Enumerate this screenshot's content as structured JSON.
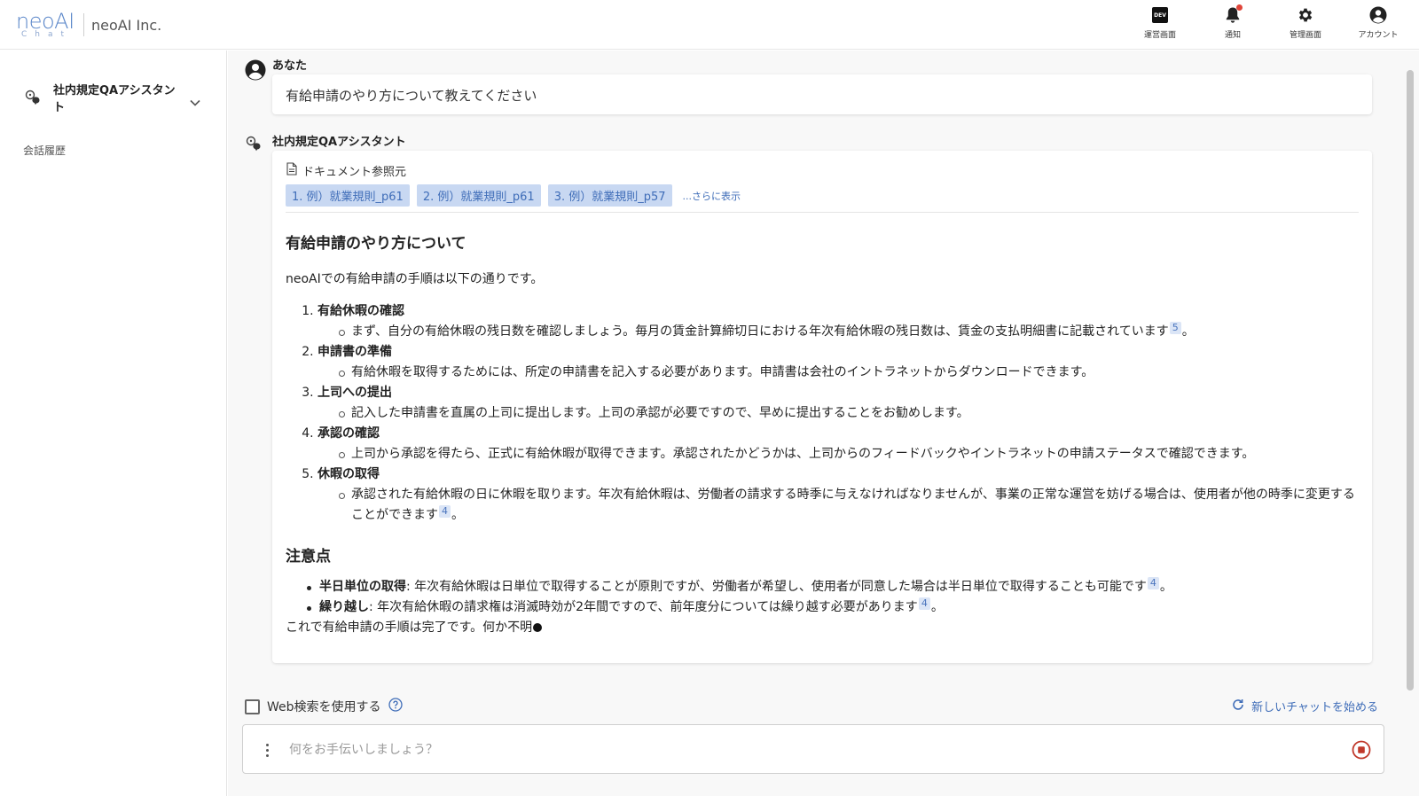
{
  "header": {
    "logo_text": "neoAI",
    "logo_sub": "Chat",
    "company": "neoAI Inc.",
    "actions": [
      {
        "label": "運営画面",
        "icon": "dev-icon",
        "badge": "DEV"
      },
      {
        "label": "通知",
        "icon": "bell-icon"
      },
      {
        "label": "管理画面",
        "icon": "gear-icon"
      },
      {
        "label": "アカウント",
        "icon": "account-icon"
      }
    ]
  },
  "sidebar": {
    "assistant_name": "社内規定QAアシスタント",
    "history_label": "会話履歴"
  },
  "chat": {
    "user": {
      "name": "あなた",
      "message": "有給申請のやり方について教えてください"
    },
    "bot": {
      "name": "社内規定QAアシスタント",
      "refs_label": "ドキュメント参照元",
      "refs": [
        "1. 例）就業規則_p61",
        "2. 例）就業規則_p61",
        "3. 例）就業規則_p57"
      ],
      "refs_more": "...さらに表示",
      "title": "有給申請のやり方について",
      "intro": "neoAIでの有給申請の手順は以下の通りです。",
      "steps": [
        {
          "title": "有給休暇の確認",
          "detail": "まず、自分の有給休暇の残日数を確認しましょう。毎月の賃金計算締切日における年次有給休暇の残日数は、賃金の支払明細書に記載されています",
          "cite": "5",
          "tail": "。"
        },
        {
          "title": "申請書の準備",
          "detail": "有給休暇を取得するためには、所定の申請書を記入する必要があります。申請書は会社のイントラネットからダウンロードできます。",
          "cite": "",
          "tail": ""
        },
        {
          "title": "上司への提出",
          "detail": "記入した申請書を直属の上司に提出します。上司の承認が必要ですので、早めに提出することをお勧めします。",
          "cite": "",
          "tail": ""
        },
        {
          "title": "承認の確認",
          "detail": "上司から承認を得たら、正式に有給休暇が取得できます。承認されたかどうかは、上司からのフィードバックやイントラネットの申請ステータスで確認できます。",
          "cite": "",
          "tail": ""
        },
        {
          "title": "休暇の取得",
          "detail": "承認された有給休暇の日に休暇を取ります。年次有給休暇は、労働者の請求する時季に与えなければなりませんが、事業の正常な運営を妨げる場合は、使用者が他の時季に変更することができます",
          "cite": "4",
          "tail": "。"
        }
      ],
      "notes_title": "注意点",
      "notes": [
        {
          "term": "半日単位の取得",
          "text": ": 年次有給休暇は日単位で取得することが原則ですが、労働者が希望し、使用者が同意した場合は半日単位で取得することも可能です",
          "cite": "4",
          "tail": "。"
        },
        {
          "term": "繰り越し",
          "text": ": 年次有給休暇の請求権は消滅時効が2年間ですので、前年度分については繰り越す必要があります",
          "cite": "4",
          "tail": "。"
        }
      ],
      "closing": "これで有給申請の手順は完了です。何か不明"
    }
  },
  "footer": {
    "web_search_label": "Web検索を使用する",
    "new_chat_label": "新しいチャットを始める",
    "input_placeholder": "何をお手伝いしましょう？"
  },
  "colors": {
    "accent": "#3f6db8",
    "chip_bg": "#c8d8f2",
    "notification": "#e0453a"
  }
}
